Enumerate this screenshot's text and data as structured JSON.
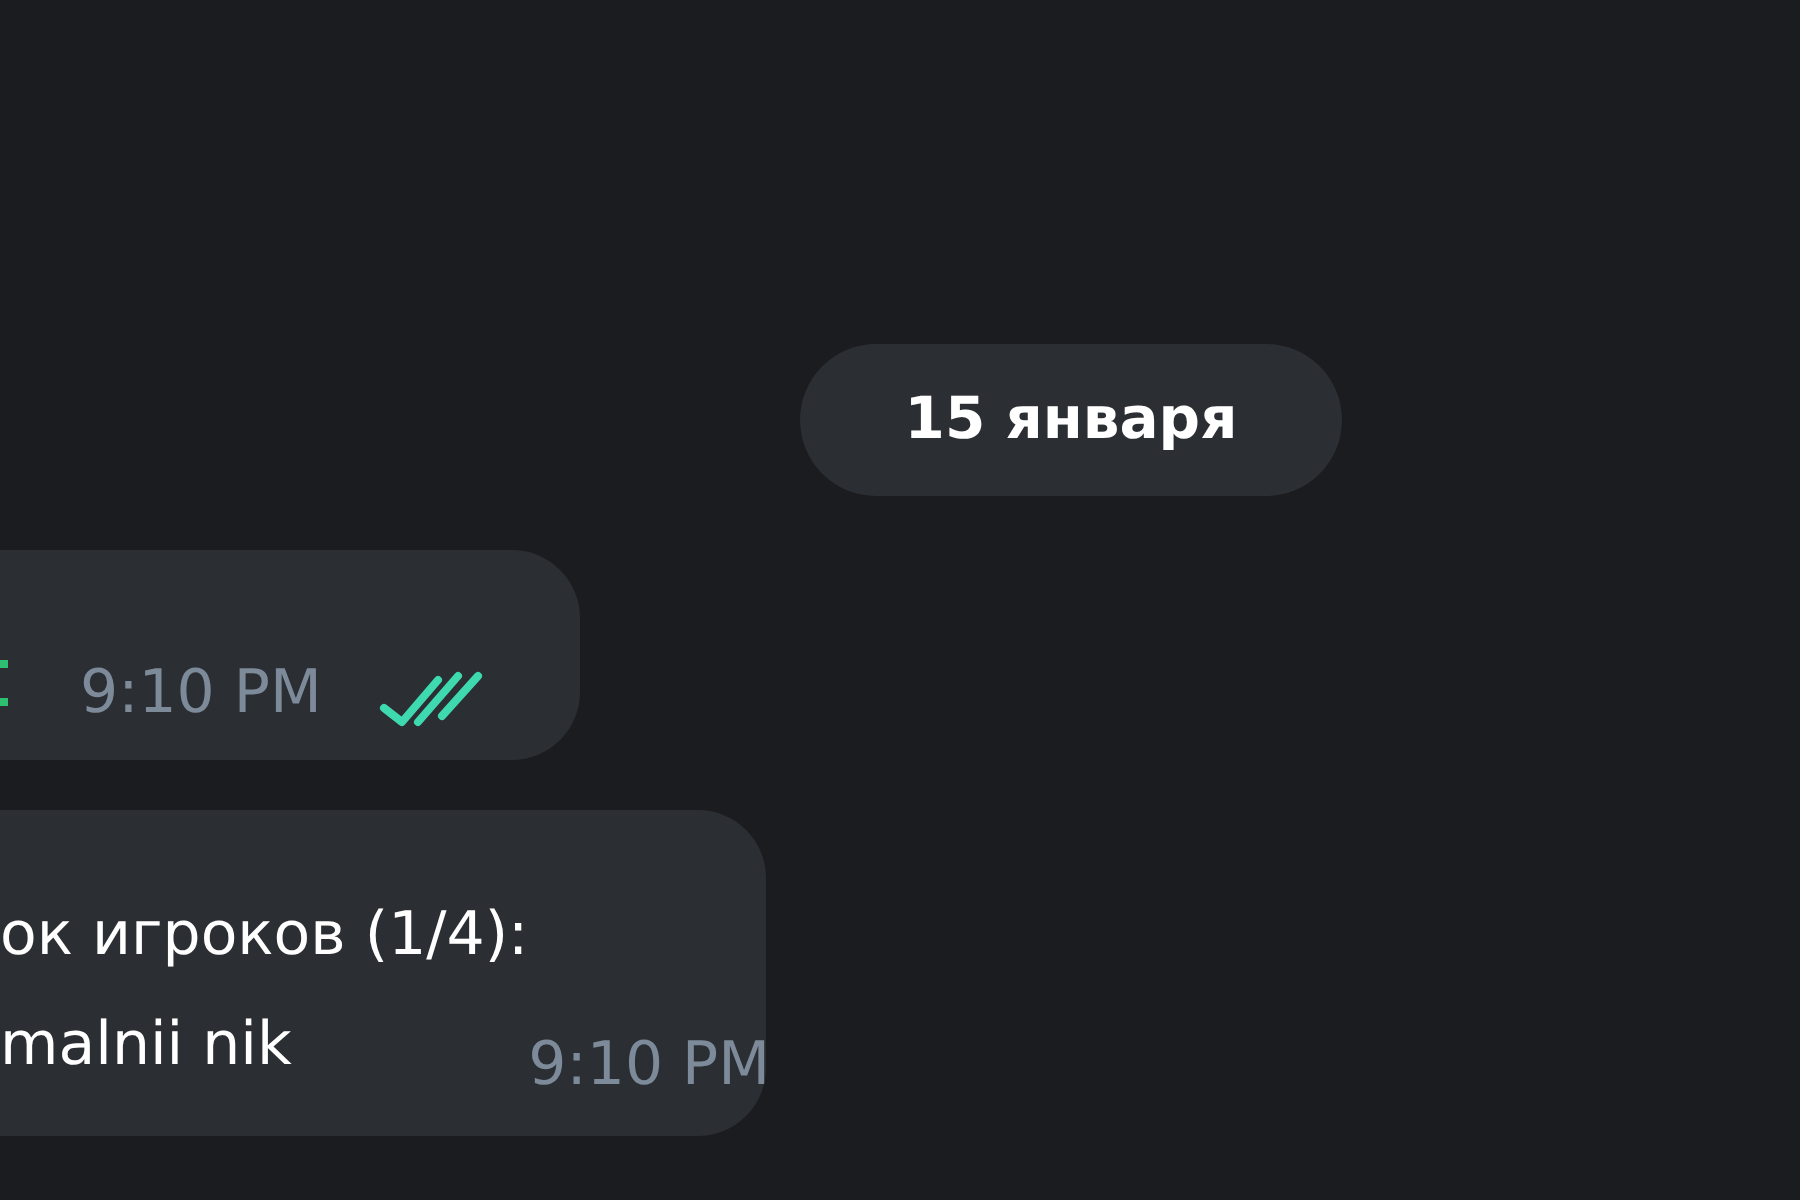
{
  "date_separator": "15 января",
  "messages": [
    {
      "time": "9:10 PM",
      "read": true
    },
    {
      "lines": [
        "ок игроков (1/4):",
        "malnii nik"
      ],
      "time": "9:10 PM"
    }
  ]
}
